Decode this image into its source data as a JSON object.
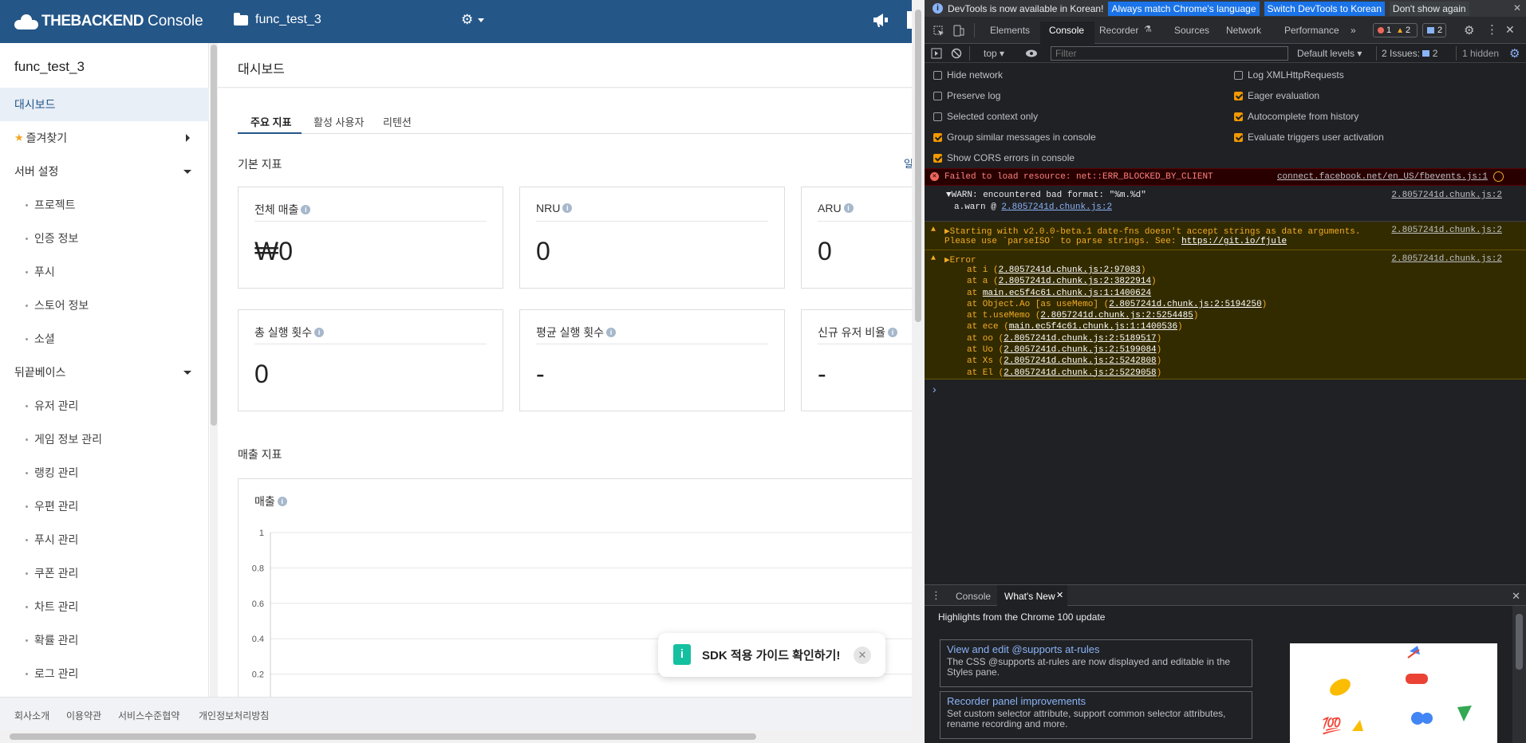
{
  "topbar": {
    "brand": "THEBACKEND",
    "console": "Console",
    "project": "func_test_3"
  },
  "sidebar": {
    "title": "func_test_3",
    "items": [
      {
        "label": "대시보드",
        "active": true
      },
      {
        "label": "즐겨찾기"
      },
      {
        "label": "서버 설정"
      },
      {
        "label": "프로젝트"
      },
      {
        "label": "인증 정보"
      },
      {
        "label": "푸시"
      },
      {
        "label": "스토어 정보"
      },
      {
        "label": "소셜"
      },
      {
        "label": "뒤끝베이스"
      },
      {
        "label": "유저 관리"
      },
      {
        "label": "게임 정보 관리"
      },
      {
        "label": "랭킹 관리"
      },
      {
        "label": "우편 관리"
      },
      {
        "label": "푸시 관리"
      },
      {
        "label": "쿠폰 관리"
      },
      {
        "label": "차트 관리"
      },
      {
        "label": "확률 관리"
      },
      {
        "label": "로그 관리"
      }
    ]
  },
  "main": {
    "title": "대시보드",
    "tabs": [
      "주요 지표",
      "활성 사용자",
      "리텐션"
    ],
    "section_basic": "기본 지표",
    "more": "일",
    "cards": [
      {
        "label": "전체 매출",
        "value": "₩0"
      },
      {
        "label": "NRU",
        "value": "0"
      },
      {
        "label": "ARU",
        "value": "0"
      },
      {
        "label": "총 실행 횟수",
        "value": "0"
      },
      {
        "label": "평균 실행 횟수",
        "value": "-"
      },
      {
        "label": "신규 유저 비율",
        "value": "-"
      }
    ],
    "section_sales": "매출 지표",
    "chart_label": "매출",
    "toast": "SDK 적용 가이드 확인하기!",
    "toast_icon": "i"
  },
  "chart_data": {
    "type": "line",
    "title": "매출",
    "x": [],
    "series": [],
    "ylim": [
      0,
      1
    ],
    "yticks": [
      "1",
      "0.8",
      "0.6",
      "0.4",
      "0.2"
    ]
  },
  "footer": [
    "회사소개",
    "이용약관",
    "서비스수준협약",
    "개인정보처리방침"
  ],
  "devtools": {
    "infobar": {
      "text": "DevTools is now available in Korean!",
      "btn1": "Always match Chrome's language",
      "btn2": "Switch DevTools to Korean",
      "btn3": "Don't show again"
    },
    "tabs": [
      "Elements",
      "Console",
      "Recorder",
      "Sources",
      "Network",
      "Performance"
    ],
    "badge_errors": "1",
    "badge_warnings": "2",
    "badge_messages": "2",
    "toolbar": {
      "context": "top",
      "filter_placeholder": "Filter",
      "levels": "Default levels",
      "issues": "2 Issues:",
      "issues_count": "2",
      "hidden": "1 hidden"
    },
    "options_left": [
      {
        "label": "Hide network",
        "checked": false
      },
      {
        "label": "Preserve log",
        "checked": false
      },
      {
        "label": "Selected context only",
        "checked": false
      },
      {
        "label": "Group similar messages in console",
        "checked": true
      },
      {
        "label": "Show CORS errors in console",
        "checked": true
      }
    ],
    "options_right": [
      {
        "label": "Log XMLHttpRequests",
        "checked": false
      },
      {
        "label": "Eager evaluation",
        "checked": true
      },
      {
        "label": "Autocomplete from history",
        "checked": true
      },
      {
        "label": "Evaluate triggers user activation",
        "checked": true
      }
    ],
    "messages": {
      "error1_text": "Failed to load resource: net::ERR_BLOCKED_BY_CLIENT",
      "error1_src": "connect.facebook.net/en_US/fbevents.js:1",
      "warn_bad_format": "▼WARN: encountered bad format: \"%m.%d\"",
      "warn_bad_src": "2.8057241d.chunk.js:2",
      "warn_sub_prefix": "a.warn @ ",
      "warn_sub_link": "2.8057241d.chunk.js:2",
      "warn2_line1": "▶Starting with v2.0.0-beta.1 date-fns doesn't accept strings as date arguments.",
      "warn2_line2_prefix": "Please use `parseISO` to parse strings. See: ",
      "warn2_link": "https://git.io/fjule",
      "warn2_src": "2.8057241d.chunk.js:2",
      "error2_head": "▶Error",
      "error2_src": "2.8057241d.chunk.js:2",
      "stack": [
        {
          "fn": "at i (",
          "link": "2.8057241d.chunk.js:2:97083",
          "end": ")"
        },
        {
          "fn": "at a (",
          "link": "2.8057241d.chunk.js:2:3822914",
          "end": ")"
        },
        {
          "fn": "at ",
          "link": "main.ec5f4c61.chunk.js:1:1400624",
          "end": ""
        },
        {
          "fn": "at Object.Ao [as useMemo] (",
          "link": "2.8057241d.chunk.js:2:5194250",
          "end": ")"
        },
        {
          "fn": "at t.useMemo (",
          "link": "2.8057241d.chunk.js:2:5254485",
          "end": ")"
        },
        {
          "fn": "at ece (",
          "link": "main.ec5f4c61.chunk.js:1:1400536",
          "end": ")"
        },
        {
          "fn": "at oo (",
          "link": "2.8057241d.chunk.js:2:5189517",
          "end": ")"
        },
        {
          "fn": "at Uo (",
          "link": "2.8057241d.chunk.js:2:5199084",
          "end": ")"
        },
        {
          "fn": "at Xs (",
          "link": "2.8057241d.chunk.js:2:5242808",
          "end": ")"
        },
        {
          "fn": "at El (",
          "link": "2.8057241d.chunk.js:2:5229058",
          "end": ")"
        }
      ],
      "prompt": "›"
    },
    "drawer": {
      "tab_console": "Console",
      "tab_whatsnew": "What's New",
      "heading": "Highlights from the Chrome 100 update",
      "cards": [
        {
          "title": "View and edit @supports at-rules",
          "desc": "The CSS @supports at-rules are now displayed and editable in the Styles pane."
        },
        {
          "title": "Recorder panel improvements",
          "desc": "Set custom selector attribute, support common selector attributes, rename recording and more."
        }
      ]
    }
  }
}
